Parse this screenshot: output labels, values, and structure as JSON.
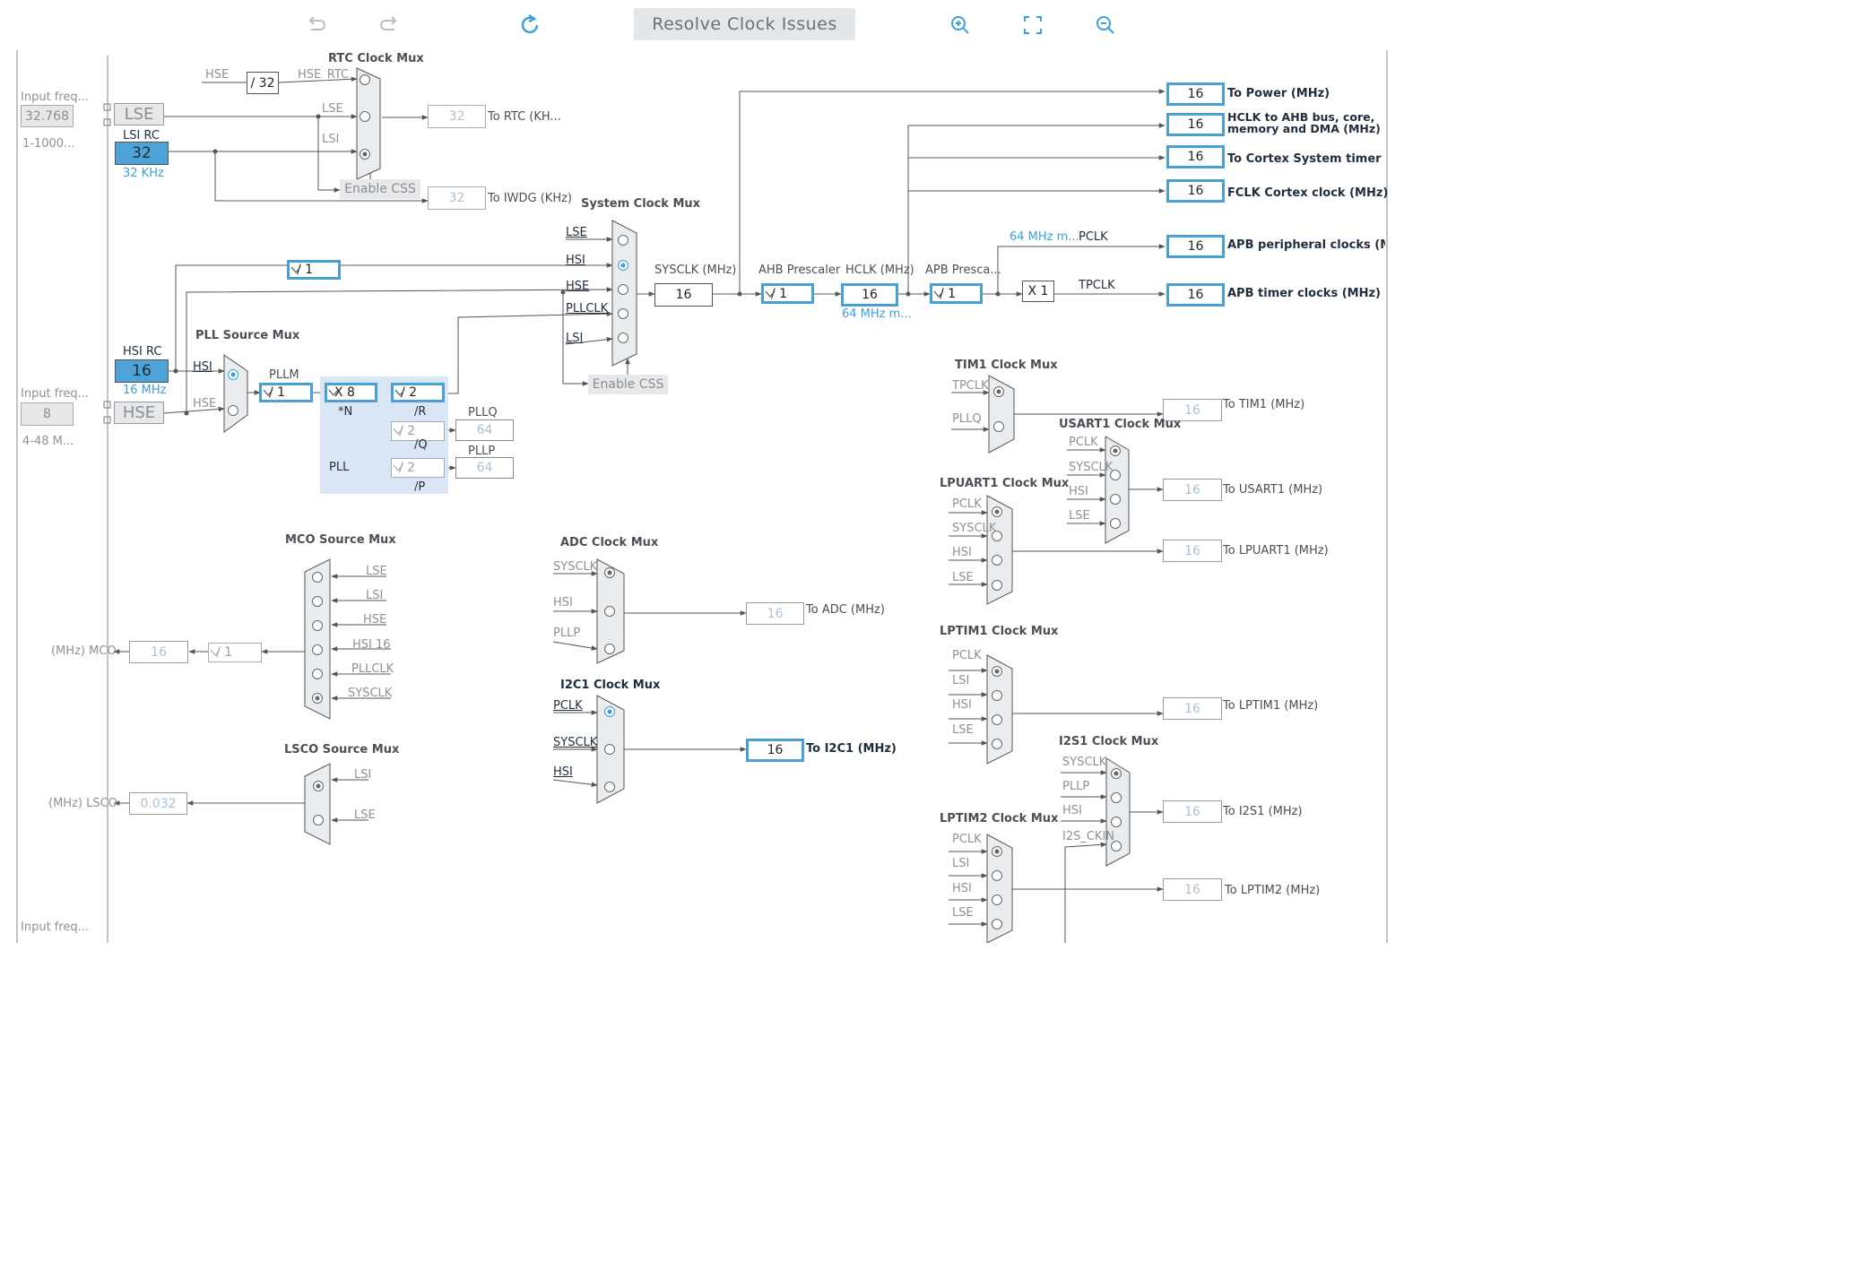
{
  "toolbar": {
    "resolve_label": "Resolve Clock Issues"
  },
  "colors": {
    "active_border": "#4a9fd4",
    "source_fill": "#4da3d8",
    "mux_fill": "#e9edf0",
    "line": "#555555"
  },
  "labels": {
    "input_freq_1": "Input freq...",
    "lse_in": "32.768",
    "range_1": "1-1000...",
    "input_freq_2": "Input freq...",
    "hse_in": "8",
    "range_2": "4-48 M...",
    "input_freq_3": "Input freq...",
    "lse": "LSE",
    "lsi_rc": "LSI RC",
    "lsi_val": "32",
    "lsi_khz": "32 KHz",
    "hsi_rc": "HSI RC",
    "hsi_val": "16",
    "hsi_mhz": "16 MHz",
    "hse": "HSE",
    "rtc_mux": "RTC Clock Mux",
    "rtc_hse": "HSE",
    "rtc_div": "/ 32",
    "hse_rtc": "HSE_RTC",
    "rtc_lse": "LSE",
    "rtc_lsi": "LSI",
    "rtc_out": "32",
    "to_rtc": "To RTC (KH...",
    "enable_css": "Enable CSS",
    "iwdg_out": "32",
    "to_iwdg": "To IWDG (KHz)",
    "sys_mux": "System Clock Mux",
    "s_lse": "LSE",
    "s_hsi": "HSI",
    "s_hse": "HSE",
    "s_pllclk": "PLLCLK",
    "s_lsi": "LSI",
    "hsi_div": "/ 1",
    "sysclk_lbl": "SYSCLK (MHz)",
    "sysclk": "16",
    "enable_css2": "Enable CSS",
    "ahb_lbl": "AHB Prescaler",
    "ahb_div": "/ 1",
    "hclk_lbl": "HCLK (MHz)",
    "hclk": "16",
    "hclk_max": "64 MHz m...",
    "apb_lbl": "APB Presca...",
    "apb_div": "/ 1",
    "pclk_max": "64 MHz m...",
    "pclk": "PCLK",
    "x1": "X 1",
    "tpclk": "TPCLK",
    "o_power": "16",
    "l_power": "To Power (MHz)",
    "o_hclk": "16",
    "l_hclk1": "HCLK to AHB bus, core,",
    "l_hclk2": "memory and DMA (MHz)",
    "o_cortex": "16",
    "l_cortex": "To Cortex System timer (MHz)",
    "o_fclk": "16",
    "l_fclk": "FCLK Cortex clock (MHz)",
    "o_apbp": "16",
    "l_apbp": "APB peripheral clocks (MHz)",
    "o_apbt": "16",
    "l_apbt": "APB timer clocks (MHz)",
    "pll_src": "PLL Source Mux",
    "p_hsi": "HSI",
    "p_hse": "HSE",
    "pllm_lbl": "PLLM",
    "pllm": "/ 1",
    "pll_n": "X 8",
    "n_lbl": "*N",
    "pll_r": "/ 2",
    "r_lbl": "/R",
    "pll_q": "/ 2",
    "q_lbl": "/Q",
    "pll_p": "/ 2",
    "p_lbl": "/P",
    "pllq_lbl": "PLLQ",
    "pllq": "64",
    "pllp_lbl": "PLLP",
    "pllp": "64",
    "pll_lbl": "PLL",
    "mco_mux": "MCO Source Mux",
    "m_lse": "LSE",
    "m_lsi": "LSI",
    "m_hse": "HSE",
    "m_hsi": "HSI 16",
    "m_pllclk": "PLLCLK",
    "m_sysclk": "SYSCLK",
    "mco_lbl": "(MHz) MCO",
    "mco_out": "16",
    "mco_div": "/ 1",
    "lsco_mux": "LSCO Source Mux",
    "ls_lsi": "LSI",
    "ls_lse": "LSE",
    "lsco_lbl": "(MHz) LSCO",
    "lsco_out": "0.032",
    "adc_mux": "ADC Clock Mux",
    "a_sysclk": "SYSCLK",
    "a_hsi": "HSI",
    "a_pllp": "PLLP",
    "adc_out": "16",
    "to_adc": "To ADC (MHz)",
    "i2c_mux": "I2C1 Clock Mux",
    "i_pclk": "PCLK",
    "i_sysclk": "SYSCLK",
    "i_hsi": "HSI",
    "i2c_out": "16",
    "to_i2c": "To I2C1 (MHz)",
    "tim1_mux": "TIM1 Clock Mux",
    "t_tpclk": "TPCLK",
    "t_pllq": "PLLQ",
    "tim1_out": "16",
    "to_tim1": "To TIM1 (MHz)",
    "usart_mux": "USART1 Clock Mux",
    "u_pclk": "PCLK",
    "u_sysclk": "SYSCLK",
    "u_hsi": "HSI",
    "u_lse": "LSE",
    "usart_out": "16",
    "to_usart": "To USART1 (MHz)",
    "lpuart_mux": "LPUART1 Clock Mux",
    "lu_pclk": "PCLK",
    "lu_sysclk": "SYSCLK",
    "lu_hsi": "HSI",
    "lu_lse": "LSE",
    "lpuart_out": "16",
    "to_lpuart": "To LPUART1 (MHz)",
    "lptim1_mux": "LPTIM1 Clock Mux",
    "l1_pclk": "PCLK",
    "l1_lsi": "LSI",
    "l1_hsi": "HSI",
    "l1_lse": "LSE",
    "lptim1_out": "16",
    "to_lptim1": "To LPTIM1 (MHz)",
    "i2s_mux": "I2S1 Clock Mux",
    "s1_sysclk": "SYSCLK",
    "s1_pllp": "PLLP",
    "s1_hsi": "HSI",
    "s1_ckin": "I2S_CKIN",
    "i2s_out": "16",
    "to_i2s": "To I2S1 (MHz)",
    "lptim2_mux": "LPTIM2 Clock Mux",
    "l2_pclk": "PCLK",
    "l2_lsi": "LSI",
    "l2_hsi": "HSI",
    "l2_lse": "LSE",
    "lptim2_out": "16",
    "to_lptim2": "To LPTIM2 (MHz)"
  }
}
